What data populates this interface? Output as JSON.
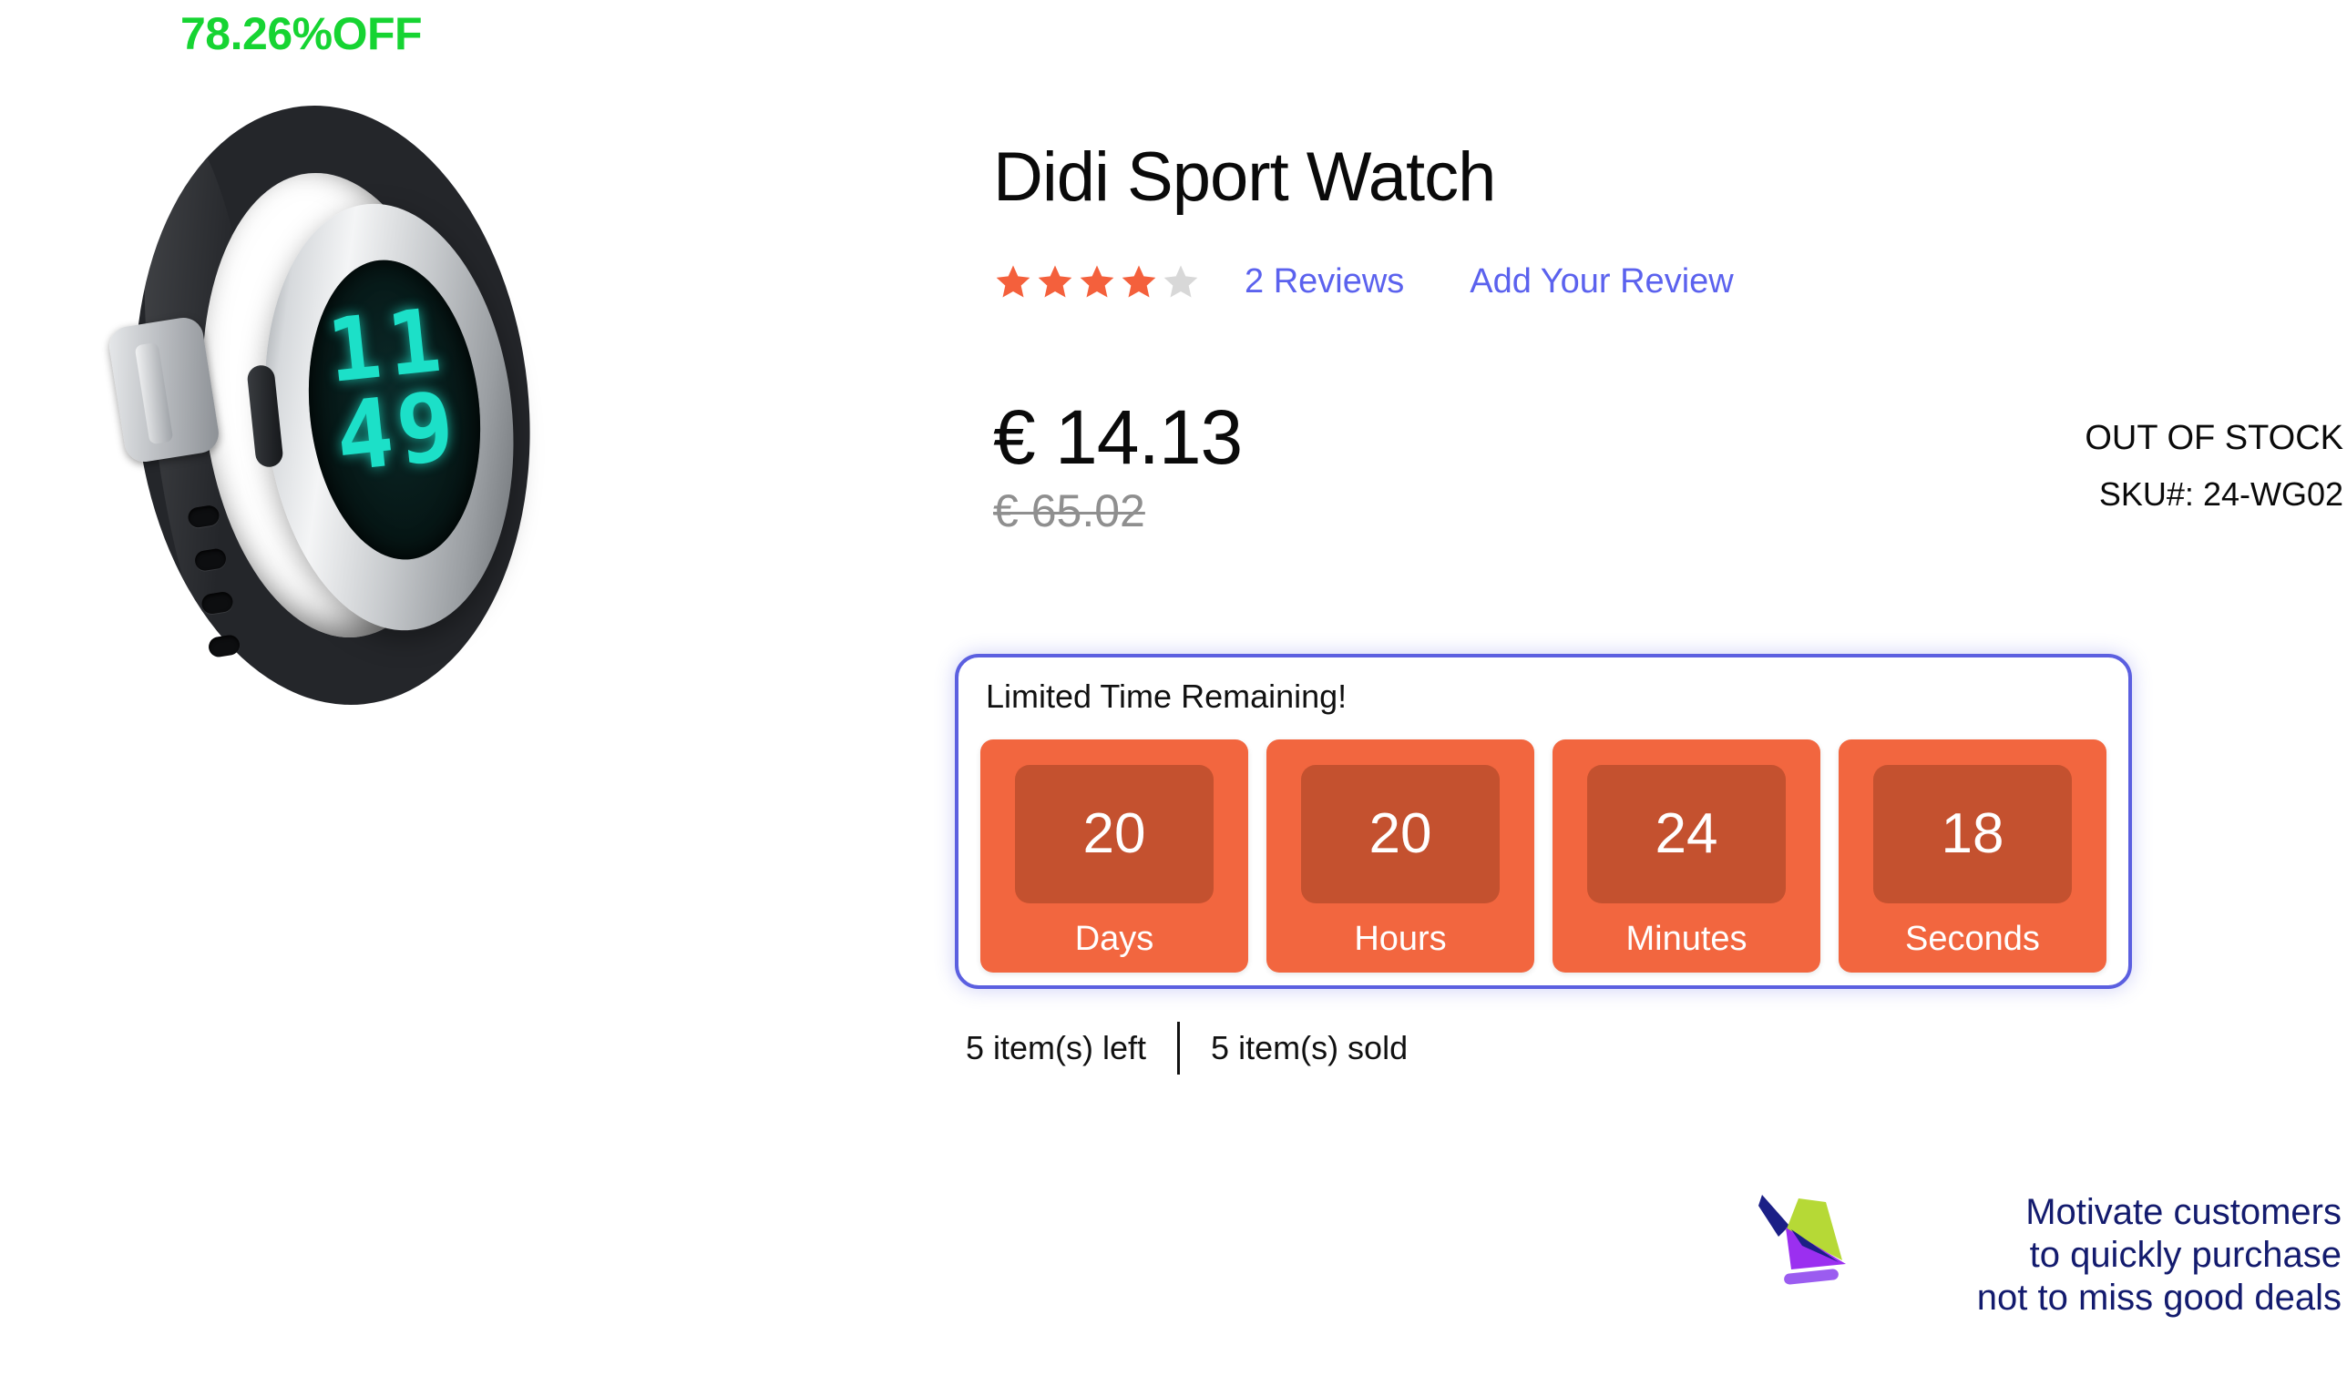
{
  "product": {
    "discount_badge": "78.26%OFF",
    "title": "Didi Sport Watch",
    "rating": {
      "filled_stars": 4,
      "total_stars": 5,
      "filled_color": "#F4603C",
      "empty_color": "#D8D8D8",
      "reviews_label": "2 Reviews",
      "add_review_label": "Add Your Review",
      "link_color": "#5B62EE"
    },
    "price": {
      "current": "€ 14.13",
      "old": "€ 65.02"
    },
    "availability": {
      "stock_status": "OUT OF STOCK",
      "sku_label": "SKU#:",
      "sku_value": "24-WG02",
      "sku_line": "SKU#:  24-WG02"
    },
    "inventory": {
      "items_left": "5 item(s) left",
      "items_sold": "5 item(s) sold"
    },
    "image": {
      "icon": "sport-watch-photo",
      "lcd_top": "11",
      "lcd_bottom": "49"
    }
  },
  "countdown": {
    "heading": "Limited Time Remaining!",
    "border_color": "#5B5FE0",
    "tile_color": "#F2663F",
    "tile_inner_color": "#C4512F",
    "tiles": [
      {
        "value": "20",
        "label": "Days"
      },
      {
        "value": "20",
        "label": "Hours"
      },
      {
        "value": "24",
        "label": "Minutes"
      },
      {
        "value": "18",
        "label": "Seconds"
      }
    ]
  },
  "annotation": {
    "icon": "arrow-pointer-icon",
    "color": "#131b6e",
    "lines": [
      "Motivate customers",
      "to quickly purchase",
      "not to miss good deals"
    ]
  }
}
